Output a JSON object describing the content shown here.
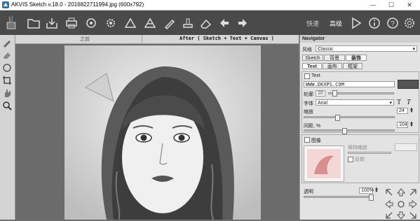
{
  "window": {
    "title": "AKVIS Sketch v.18.0 - 2016822711994.jpg (600x792)",
    "minimize": "—",
    "maximize": "☐",
    "close": "✕"
  },
  "toolbar": {
    "quick_label": "快速",
    "mode_label": "高级"
  },
  "canvas": {
    "before_tab": "之前",
    "after_tab": "After ( Sketch + Text + Canvas )"
  },
  "panel": {
    "navigator": "Navigator",
    "style_label": "风格",
    "style_value": "Classic",
    "tabs": [
      "Sketch",
      "背景",
      "装饰"
    ],
    "subtabs": [
      "Text",
      "画布",
      "框架"
    ],
    "text_check_label": "Text",
    "text_value": "WWW.DKXPS.COM",
    "outline_label": "轮廓",
    "outline_value": "10",
    "font_label": "字体",
    "font_value": "Arial",
    "font_size": "24",
    "scale_label": "缩放",
    "spacing_label": "间距, %",
    "spacing_value": "104",
    "image_label": "图像",
    "keep_ratio_label": "保持缩放",
    "reverse_label": "反转",
    "opacity_label": "透明",
    "opacity_value": "100%",
    "colors": {
      "text_color": "#555555"
    }
  }
}
